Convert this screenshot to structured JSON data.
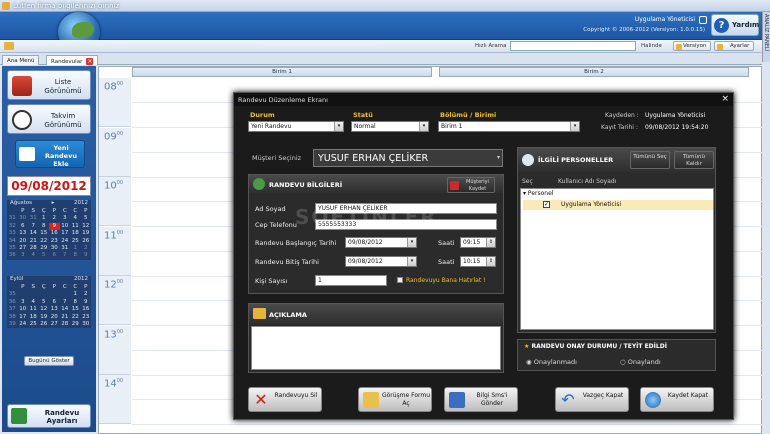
{
  "window": {
    "title": "Lutfen firma bilgilerinizi giriniz"
  },
  "header": {
    "user": "Uygulama Yöneticisi",
    "copyright": "Copyright © 2006-2012 (Versiyon: 1.0.0.15)",
    "help_label": "Yardım",
    "side_panel_label": "ANALİZ PANELİ"
  },
  "toolbar": {
    "quick_search_label": "Hızlı Arama",
    "status_label": "Halinde",
    "version_label": "Versiyon",
    "settings_label": "Ayarlar"
  },
  "tabs": [
    {
      "label": "Ana Menü"
    },
    {
      "label": "Randevular"
    }
  ],
  "sidebar": {
    "list_view": "Liste Görünümü",
    "calendar_view": "Takvim Görünümü",
    "new_appointment": "Yeni Randevu Ekle",
    "selected_date": "09/08/2012",
    "today_button": "Bugünü Göster",
    "settings_button": "Randevu Ayarları"
  },
  "calendar_august": {
    "month": "Ağustos",
    "year": "2012",
    "day_headers": [
      "P",
      "S",
      "Ç",
      "P",
      "C",
      "C",
      "P"
    ],
    "weeks": [
      {
        "wk": "31",
        "days": [
          "30",
          "31",
          "1",
          "2",
          "3",
          "4",
          "5"
        ]
      },
      {
        "wk": "32",
        "days": [
          "6",
          "7",
          "8",
          "9",
          "10",
          "11",
          "12"
        ]
      },
      {
        "wk": "33",
        "days": [
          "13",
          "14",
          "15",
          "16",
          "17",
          "18",
          "19"
        ]
      },
      {
        "wk": "34",
        "days": [
          "20",
          "21",
          "22",
          "23",
          "24",
          "25",
          "26"
        ]
      },
      {
        "wk": "35",
        "days": [
          "27",
          "28",
          "29",
          "30",
          "31",
          "1",
          "2"
        ]
      },
      {
        "wk": "36",
        "days": [
          "3",
          "4",
          "5",
          "6",
          "7",
          "8",
          "9"
        ]
      }
    ],
    "selected_day": "9"
  },
  "calendar_september": {
    "month": "Eylül",
    "year": "2012",
    "day_headers": [
      "P",
      "S",
      "Ç",
      "P",
      "C",
      "C",
      "P"
    ],
    "weeks": [
      {
        "wk": "35",
        "days": [
          "",
          "",
          "",
          "",
          "",
          "1",
          "2"
        ]
      },
      {
        "wk": "36",
        "days": [
          "3",
          "4",
          "5",
          "6",
          "7",
          "8",
          "9"
        ]
      },
      {
        "wk": "37",
        "days": [
          "10",
          "11",
          "12",
          "13",
          "14",
          "15",
          "16"
        ]
      },
      {
        "wk": "38",
        "days": [
          "17",
          "18",
          "19",
          "20",
          "21",
          "22",
          "23"
        ]
      },
      {
        "wk": "39",
        "days": [
          "24",
          "25",
          "26",
          "27",
          "28",
          "29",
          "30"
        ]
      }
    ]
  },
  "schedule": {
    "columns": [
      "Birim 1",
      "Birim 2"
    ],
    "hours": [
      "08",
      "09",
      "10",
      "11",
      "12",
      "13",
      "14"
    ],
    "minutes": "00"
  },
  "dialog": {
    "title": "Randevu Düzenleme Ekranı",
    "status_label": "Durum",
    "status_value": "Yeni Randevu",
    "statu_label": "Statü",
    "statu_value": "Normal",
    "unit_label": "Bölümü / Birimi",
    "unit_value": "Birim 1",
    "recorded_by_label": "Kaydeden :",
    "recorded_by": "Uygulama Yöneticisi",
    "record_date_label": "Kayıt Tarihi :",
    "record_date": "09/08/2012 19:54:20",
    "customer_label": "Müşteri Seçiniz",
    "customer_value": "YUSUF ERHAN ÇELİKER",
    "info_header": "RANDEVU BİLGİLERİ",
    "save_customer": "Müşteriyi Kaydet",
    "name_label": "Ad Soyad",
    "name_value": "YUSUF ERHAN ÇELİKER",
    "phone_label": "Cep Telefonu",
    "phone_value": "5555553333",
    "start_label": "Randevu Başlangıç Tarihi",
    "start_date": "09/08/2012",
    "start_time_label": "Saati",
    "start_time": "09:15",
    "end_label": "Randevu Bitiş Tarihi",
    "end_date": "09/08/2012",
    "end_time_label": "Saati",
    "end_time": "10:15",
    "people_label": "Kişi Sayısı",
    "people_value": "1",
    "remind_label": "Randevuyu Bana Hatırlat !",
    "notes_header": "AÇIKLAMA",
    "staff_header": "İLGİLİ PERSONELLER",
    "select_all": "Tümünü Seç",
    "remove_all": "Tümünü Kaldır",
    "staff_col_select": "Seç",
    "staff_col_name": "Kullanıcı Adı Soyadı",
    "staff_group": "Personel",
    "staff_item": "Uygulama Yöneticisi",
    "approval_header": "RANDEVU ONAY DURUMU / TEYİT EDİLDİ",
    "not_approved": "Onaylanmadı",
    "approved": "Onaylandı",
    "delete_btn": "Randevuyu Sil",
    "meeting_btn": "Görüşme Formu Aç",
    "sms_btn": "Bilgi Sms'i Gönder",
    "cancel_btn": "Vazgeç Kapat",
    "save_btn": "Kaydet Kapat",
    "watermark": "SOFTINLER"
  },
  "colors": {
    "accent": "#1d56a3",
    "highlight": "#f0c020",
    "selected_date": "#d01414"
  }
}
